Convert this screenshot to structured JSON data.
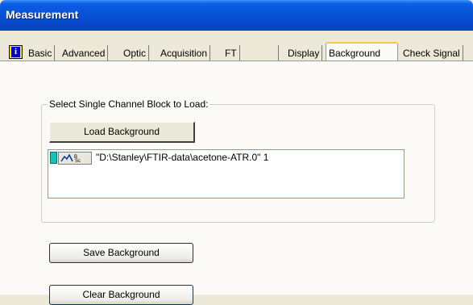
{
  "window": {
    "title": "Measurement"
  },
  "tabs": [
    {
      "label": "Basic"
    },
    {
      "label": "Advanced"
    },
    {
      "label": "Optic"
    },
    {
      "label": "Acquisition"
    },
    {
      "label": "FT"
    },
    {
      "label": "Display"
    },
    {
      "label": "Background",
      "active": true
    },
    {
      "label": "Check Signal"
    }
  ],
  "group": {
    "label": "Select Single Channel Block to Load:"
  },
  "buttons": {
    "load": "Load Background",
    "save": "Save Background",
    "clear": "Clear Background"
  },
  "file_list": [
    {
      "icon": "spectrum-bsc-icon",
      "text": "\"D:\\Stanley\\FTIR-data\\acetone-ATR.0\" 1"
    }
  ],
  "colors": {
    "title_bar": "#0a5fe8",
    "active_tab_highlight": "#ffc83c"
  }
}
